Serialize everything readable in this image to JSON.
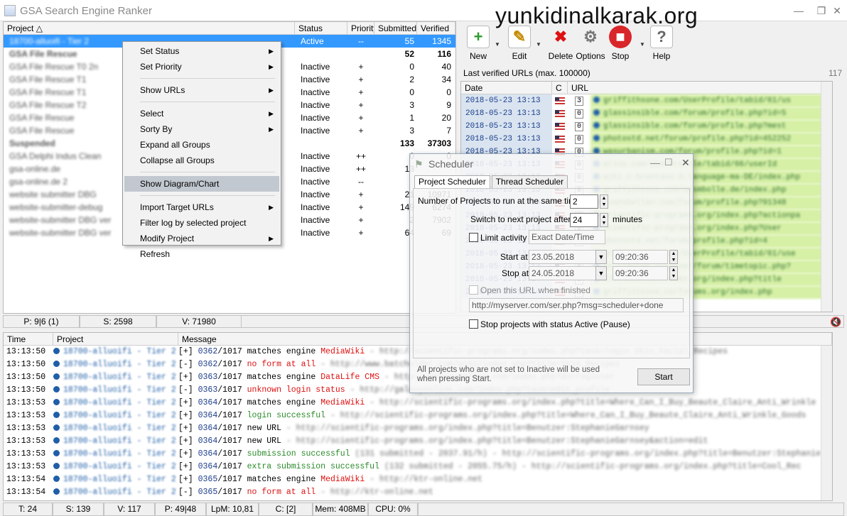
{
  "window": {
    "title": "GSA Search Engine Ranker",
    "watermark": "yunkidinalkarak.org"
  },
  "projects": {
    "columns": {
      "project": "Project",
      "status": "Status",
      "priority": "Priority",
      "submitted": "Submitted",
      "verified": "Verified"
    },
    "rows": [
      {
        "name": "18700-alluoifi - Tier 2",
        "status": "Active",
        "priority": "--",
        "submitted": "55",
        "verified": "1345",
        "selected": true
      },
      {
        "name": "GSA File Rescue",
        "status": "",
        "priority": "",
        "submitted": "52",
        "verified": "116",
        "bold": true
      },
      {
        "name": "GSA File Rescue T0 2n",
        "status": "Inactive",
        "priority": "+",
        "submitted": "0",
        "verified": "40"
      },
      {
        "name": "GSA File Rescue T1",
        "status": "Inactive",
        "priority": "+",
        "submitted": "2",
        "verified": "34"
      },
      {
        "name": "GSA File Rescue T1",
        "status": "Inactive",
        "priority": "+",
        "submitted": "0",
        "verified": "0"
      },
      {
        "name": "GSA File Rescue T2",
        "status": "Inactive",
        "priority": "+",
        "submitted": "3",
        "verified": "9"
      },
      {
        "name": "GSA File Rescue",
        "status": "Inactive",
        "priority": "+",
        "submitted": "1",
        "verified": "20"
      },
      {
        "name": "GSA File Rescue",
        "status": "Inactive",
        "priority": "+",
        "submitted": "3",
        "verified": "7"
      },
      {
        "name": "Suspended",
        "status": "",
        "priority": "",
        "submitted": "133",
        "verified": "37303",
        "bold": true
      },
      {
        "name": "GSA Delphi Indus Clean",
        "status": "Inactive",
        "priority": "++",
        "submitted": "0",
        "verified": "0"
      },
      {
        "name": "gsa-online.de",
        "status": "Inactive",
        "priority": "++",
        "submitted": "13",
        "verified": ""
      },
      {
        "name": "gsa-online.de 2",
        "status": "Inactive",
        "priority": "--",
        "submitted": "",
        "verified": ""
      },
      {
        "name": "website submitter DBG",
        "status": "Inactive",
        "priority": "+",
        "submitted": "21",
        "verified": "10971"
      },
      {
        "name": "website-submitter-debug",
        "status": "Inactive",
        "priority": "+",
        "submitted": "149",
        "verified": "6274"
      },
      {
        "name": "website-submitter DBG ver",
        "status": "Inactive",
        "priority": "+",
        "submitted": "2",
        "verified": "7902"
      },
      {
        "name": "website-submitter DBG ver",
        "status": "Inactive",
        "priority": "+",
        "submitted": "64",
        "verified": "69"
      }
    ]
  },
  "context_menu": {
    "items": [
      {
        "label": "Set Status",
        "submenu": true
      },
      {
        "label": "Set Priority",
        "submenu": true
      },
      {
        "label": "Show URLs",
        "submenu": true
      },
      {
        "label": "Select",
        "submenu": true
      },
      {
        "label": "Sorty By",
        "submenu": true
      },
      {
        "label": "Expand all Groups",
        "submenu": false
      },
      {
        "label": "Collapse all Groups",
        "submenu": false
      },
      {
        "label": "Show Diagram/Chart",
        "submenu": false,
        "highlight": true
      },
      {
        "label": "Import Target URLs",
        "submenu": true
      },
      {
        "label": "Filter log by selected project",
        "submenu": false
      },
      {
        "label": "Modify Project",
        "submenu": true
      },
      {
        "label": "Refresh",
        "submenu": false
      }
    ]
  },
  "status_top": {
    "p": "P: 9|6 (1)",
    "s": "S: 2598",
    "v": "V: 71980"
  },
  "toolbar": {
    "new": "New",
    "edit": "Edit",
    "delete": "Delete",
    "options": "Options",
    "stop": "Stop",
    "help": "Help"
  },
  "verified": {
    "label": "Last verified URLs (max. 100000)",
    "count": "117",
    "columns": {
      "date": "Date",
      "c": "C",
      "url": "URL"
    },
    "rows": [
      {
        "date": "2018-05-23 13:13",
        "c": "3",
        "url": "griffithsone.com/UserProfile/tabid/61/us"
      },
      {
        "date": "2018-05-23 13:13",
        "c": "0",
        "url": "glassinsible.com/forum/profile.php?id=5"
      },
      {
        "date": "2018-05-23 13:13",
        "c": "0",
        "url": "glassinsible.com/forum/profile.php?mest"
      },
      {
        "date": "2018-05-23 13:13",
        "c": "0",
        "url": "photostd.net/forum/profile.php?id=452252"
      },
      {
        "date": "2018-05-23 13:13",
        "c": "0",
        "url": "wasurbanism.com/forum/profile.php?id=1"
      },
      {
        "date": "2018-05-23 13:13",
        "c": "0",
        "url": "atssa.com/UserProfile/tabid/66/userId"
      },
      {
        "date": "2018-05-23 13:13",
        "c": "0",
        "url": "wiki.c-brentano-d.language-ma-DE/index.php"
      },
      {
        "date": "2018-05-23 13:13",
        "c": "0",
        "url": "griffithsone.com/mesmbolle.de/index.php"
      },
      {
        "date": "2018-05-23 13:13",
        "c": "0",
        "url": "guansbellan.com/forum/profile.php?91348"
      },
      {
        "date": "2018-05-23 13:13",
        "c": "0",
        "url": "scientific-programs.org/index.php?actionpa"
      },
      {
        "date": "2018-05-23 13:13",
        "c": "0",
        "url": "scientific-programs.org/index.php?User"
      },
      {
        "date": "2018-05-23 13:13",
        "c": "0",
        "url": "photostd.net/forum/profile.php?id=4"
      },
      {
        "date": "2018-05-23 13:13",
        "c": "0",
        "url": "griffithsone.com/UserProfile/tabid/61/use"
      },
      {
        "date": "2018-05-23 13:13",
        "c": "0",
        "url": "cm.simstep.org/user/forum/timetopic.php?"
      },
      {
        "date": "2018-05-23 13:14",
        "c": "0",
        "url": "277slots.co/forums.org/index.php?title"
      },
      {
        "date": "2018-05-23 13:14",
        "c": "0",
        "url": "griffithsone.co/forums.org/index.php"
      }
    ]
  },
  "log": {
    "columns": {
      "time": "Time",
      "project": "Project",
      "message": "Message"
    },
    "rows": [
      {
        "time": "13:13:50",
        "project": "18700-alluoifi - Tier 2",
        "tag": "[+]",
        "num": "0362",
        "tot": "/1017",
        "kind": "",
        "text": "matches engine",
        "hl": "MediaWiki",
        "hlc": "red",
        "rest": " - http://scientific-programs.org/index.php?task=login Skin_Facial_Recipes"
      },
      {
        "time": "13:13:50",
        "project": "18700-alluoifi - Tier 2",
        "tag": "[-]",
        "num": "0362",
        "tot": "/1017",
        "kind": "red",
        "text": "no form at all",
        "hl": "",
        "hlc": "",
        "rest": " - http://www.batchelder.com/wiki/index.php?title=Skin_Recipes"
      },
      {
        "time": "13:13:50",
        "project": "18700-alluoifi - Tier 2",
        "tag": "[+]",
        "num": "0363",
        "tot": "/1017",
        "kind": "",
        "text": "matches engine",
        "hl": "DataLife CMS",
        "hlc": "red",
        "rest": " - http://galaxyonline.com/index.php?do=register"
      },
      {
        "time": "13:13:50",
        "project": "18700-alluoifi - Tier 2",
        "tag": "[-]",
        "num": "0363",
        "tot": "/1017",
        "kind": "red",
        "text": "unknown login status",
        "hl": "",
        "hlc": "",
        "rest": " - http://galaxyonline.com/index.php?task=edit_profile"
      },
      {
        "time": "13:13:53",
        "project": "18700-alluoifi - Tier 2",
        "tag": "[+]",
        "num": "0364",
        "tot": "/1017",
        "kind": "",
        "text": "matches engine",
        "hl": "MediaWiki",
        "hlc": "red",
        "rest": " - http://scientific-programs.org/index.php?title=Where_Can_I_Buy_Beaute_Claire_Anti_Wrinkle"
      },
      {
        "time": "13:13:53",
        "project": "18700-alluoifi - Tier 2",
        "tag": "[+]",
        "num": "0364",
        "tot": "/1017",
        "kind": "green",
        "text": "login successful",
        "hl": "",
        "hlc": "",
        "rest": " - http://scientific-programs.org/index.php?title=Where_Can_I_Buy_Beaute_Claire_Anti_Wrinkle_Goods"
      },
      {
        "time": "13:13:53",
        "project": "18700-alluoifi - Tier 2",
        "tag": "[+]",
        "num": "0364",
        "tot": "/1017",
        "kind": "",
        "text": "new URL",
        "hl": "",
        "hlc": "",
        "rest": " - http://scientific-programs.org/index.php?title=Benutzer:StephanieGarnsey"
      },
      {
        "time": "13:13:53",
        "project": "18700-alluoifi - Tier 2",
        "tag": "[+]",
        "num": "0364",
        "tot": "/1017",
        "kind": "",
        "text": "new URL",
        "hl": "",
        "hlc": "",
        "rest": " - http://scientific-programs.org/index.php?title=Benutzer:StephanieGarnsey&action=edit"
      },
      {
        "time": "13:13:53",
        "project": "18700-alluoifi - Tier 2",
        "tag": "[+]",
        "num": "0364",
        "tot": "/1017",
        "kind": "green",
        "text": "submission successful",
        "hl": "",
        "hlc": "",
        "rest": " (131 submitted - 2037.91/h) - http://scientific-programs.org/index.php?title=Benutzer:Stephanie"
      },
      {
        "time": "13:13:53",
        "project": "18700-alluoifi - Tier 2",
        "tag": "[+]",
        "num": "0364",
        "tot": "/1017",
        "kind": "green",
        "text": "extra submission successful",
        "hl": "",
        "hlc": "",
        "rest": " (132 submitted - 2055.75/h) - http://scientific-programs.org/index.php?title=Cool_Rec"
      },
      {
        "time": "13:13:54",
        "project": "18700-alluoifi - Tier 2",
        "tag": "[+]",
        "num": "0365",
        "tot": "/1017",
        "kind": "",
        "text": "matches engine",
        "hl": "MediaWiki",
        "hlc": "red",
        "rest": " - http://ktr-online.net"
      },
      {
        "time": "13:13:54",
        "project": "18700-alluoifi - Tier 2",
        "tag": "[-]",
        "num": "0365",
        "tot": "/1017",
        "kind": "red",
        "text": "no form at all",
        "hl": "",
        "hlc": "",
        "rest": " - http://ktr-online.net"
      }
    ]
  },
  "bottom_status": {
    "t": "T: 24",
    "s": "S: 139",
    "v": "V: 117",
    "p": "P: 49|48",
    "lpm": "LpM: 10,81",
    "c": "C:  [2]",
    "mem": "Mem: 408MB",
    "cpu": "CPU: 0%"
  },
  "scheduler": {
    "title": "Scheduler",
    "tab_project": "Project Scheduler",
    "tab_thread": "Thread Scheduler",
    "num_projects_label": "Number of Projects to run at the same time",
    "num_projects_value": "2",
    "switch_label": "Switch to next project after",
    "switch_value": "24",
    "minutes_label": "minutes",
    "limit_label": "Limit activity",
    "limit_mode": "Exact Date/Time",
    "start_label": "Start at",
    "start_date": "23.05.2018",
    "start_time": "09:20:36",
    "stop_label": "Stop at",
    "stop_date": "24.05.2018",
    "stop_time": "09:20:36",
    "open_url_label": "Open this URL when finished",
    "open_url_value": "http://myserver.com/ser.php?msg=scheduler+done",
    "stop_status_label": "Stop projects with status Active (Pause)",
    "info_text": "All projects who are not set to Inactive will be used when pressing Start.",
    "start_button": "Start"
  }
}
